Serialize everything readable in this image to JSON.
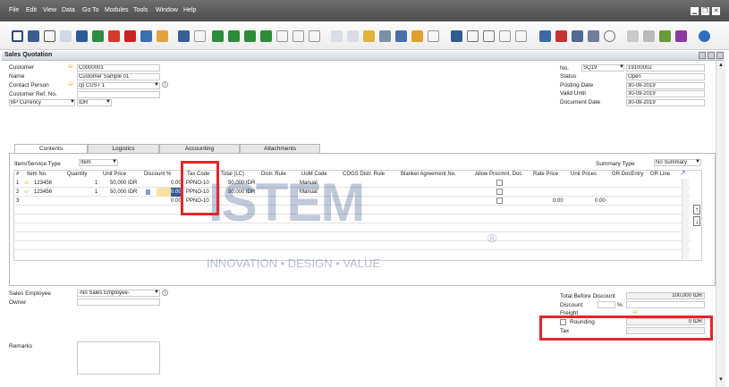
{
  "menu": {
    "items": [
      "File",
      "Edit",
      "View",
      "Data",
      "Go To",
      "Modules",
      "Tools",
      "Window",
      "Help"
    ]
  },
  "window": {
    "title": "Sales Quotation",
    "controls": [
      "minimize-icon",
      "restore-icon",
      "close-icon"
    ]
  },
  "header_left": {
    "customer": {
      "label": "Customer",
      "value": "C0000001"
    },
    "name": {
      "label": "Name",
      "value": "Customer Sample 01"
    },
    "contact": {
      "label": "Contact Person",
      "value": "cp CUST 1"
    },
    "ref": {
      "label": "Customer Ref. No.",
      "value": ""
    },
    "currency": {
      "label": "BP Currency",
      "value": "IDR"
    }
  },
  "header_right": {
    "no": {
      "label": "No.",
      "series": "SQ19",
      "value": "19100002"
    },
    "status": {
      "label": "Status",
      "value": "Open"
    },
    "posting": {
      "label": "Posting Date",
      "value": "30-08-2019"
    },
    "valid": {
      "label": "Valid Until",
      "value": "30-09-2019"
    },
    "docdate": {
      "label": "Document Date",
      "value": "30-08-2019"
    }
  },
  "tabs": [
    "Contents",
    "Logistics",
    "Accounting",
    "Attachments"
  ],
  "item_type": {
    "label": "Item/Service Type",
    "value": "Item"
  },
  "summary_type": {
    "label": "Summary Type",
    "value": "No Summary"
  },
  "grid": {
    "columns": [
      "#",
      "Item No.",
      "Quantity",
      "Unit Price",
      "Discount %",
      "Tax Code",
      "Total (LC)",
      "Distr. Rule",
      "UoM Code",
      "COGS Distr. Rule",
      "Blanket Agreement No.",
      "Allow Procmnt. Doc.",
      "Rate Price",
      "Unit Prices",
      "GR DocEntry",
      "GR Line"
    ],
    "rows": [
      {
        "num": "1",
        "item": "123456",
        "qty": "1",
        "price": "50,000 IDR",
        "disc": "0.00",
        "tax": "PPNO-10",
        "total": "50,000 IDR",
        "uom": "Manual",
        "rate": "",
        "unit": ""
      },
      {
        "num": "2",
        "item": "123456",
        "qty": "1",
        "price": "50,000 IDR",
        "disc": "0.00",
        "tax": "PPNO-10",
        "total": "50,000 IDR",
        "uom": "Manual",
        "rate": "",
        "unit": ""
      },
      {
        "num": "3",
        "item": "",
        "qty": "",
        "price": "",
        "disc": "0.00",
        "tax": "PPNO-10",
        "total": "",
        "uom": "",
        "rate": "0.00",
        "unit": "0.00"
      }
    ]
  },
  "footer_left": {
    "sales_employee": {
      "label": "Sales Employee",
      "value": "-No Sales Employee-"
    },
    "owner": {
      "label": "Owner",
      "value": ""
    },
    "remarks": {
      "label": "Remarks",
      "value": ""
    }
  },
  "totals": {
    "before_discount": {
      "label": "Total Before Discount",
      "value": "100,000 IDR"
    },
    "discount": {
      "label": "Discount",
      "unit": "%"
    },
    "freight": {
      "label": "Freight"
    },
    "rounding": {
      "label": "Rounding",
      "value": "0 IDR"
    },
    "tax": {
      "label": "Tax"
    }
  },
  "watermark": {
    "main": "ISTEM",
    "sub": "INNOVATION • DESIGN • VALUE",
    "mark": "®"
  }
}
